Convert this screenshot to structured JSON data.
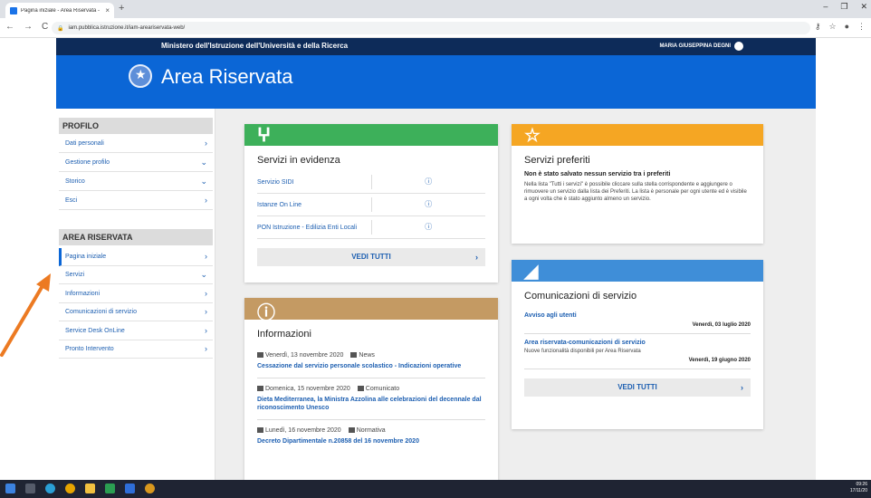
{
  "browser": {
    "tab_title": "Pagina iniziale - Area Riservata -",
    "tab_close": "×",
    "new_tab": "+",
    "url": "iam.pubblica.istruzione.it/iam-areariservata-web/"
  },
  "header": {
    "ministry": "Ministero dell'Istruzione dell'Università e della Ricerca",
    "user_name": "MARIA GIUSEPPINA DEGNI",
    "site_title": "Area Riservata"
  },
  "sidebar": {
    "profilo_title": "PROFILO",
    "profilo_items": [
      {
        "label": "Dati personali",
        "chevron": "›"
      },
      {
        "label": "Gestione profilo",
        "chevron": "⌄"
      },
      {
        "label": "Storico",
        "chevron": "⌄"
      },
      {
        "label": "Esci",
        "chevron": "›"
      }
    ],
    "area_title": "AREA RISERVATA",
    "area_items": [
      {
        "label": "Pagina iniziale",
        "chevron": "›"
      },
      {
        "label": "Servizi",
        "chevron": "⌄"
      },
      {
        "label": "Informazioni",
        "chevron": "›"
      },
      {
        "label": "Comunicazioni di servizio",
        "chevron": "›"
      },
      {
        "label": "Service Desk OnLine",
        "chevron": "›"
      },
      {
        "label": "Pronto Intervento",
        "chevron": "›"
      }
    ]
  },
  "servizi_evidenza": {
    "title": "Servizi in evidenza",
    "items": [
      "Servizio SIDI",
      "Istanze On Line",
      "PON Istruzione - Edilizia Enti Locali"
    ],
    "button": "VEDI TUTTI"
  },
  "servizi_preferiti": {
    "title": "Servizi preferiti",
    "bold": "Non è stato salvato nessun servizio tra i preferiti",
    "text": "Nella lista \"Tutti i servizi\" è possibile cliccare sulla stella corrispondente e aggiungere o rimuovere un servizio dalla lista dei Preferiti. La lista è personale per ogni utente ed è visibile a ogni volta che è stato aggiunto almeno un servizio."
  },
  "informazioni": {
    "title": "Informazioni",
    "news": [
      {
        "date": "Venerdì, 13 novembre 2020",
        "type": "News",
        "title": "Cessazione dal servizio personale scolastico - Indicazioni operative"
      },
      {
        "date": "Domenica, 15 novembre 2020",
        "type": "Comunicato",
        "title": "Dieta Mediterranea, la Ministra Azzolina alle celebrazioni del decennale dal riconoscimento Unesco"
      },
      {
        "date": "Lunedì, 16 novembre 2020",
        "type": "Normativa",
        "title": "Decreto Dipartimentale n.20858 del 16 novembre 2020"
      }
    ]
  },
  "comunicazioni": {
    "title": "Comunicazioni di servizio",
    "items": [
      {
        "link": "Avviso agli utenti",
        "text": "",
        "date": "Venerdì, 03 luglio 2020"
      },
      {
        "link": "Area riservata-comunicazioni di servizio",
        "text": "Nuove funzionalità disponibili per Area Riservata",
        "date": "Venerdì, 19 giugno 2020"
      }
    ],
    "button": "VEDI TUTTI"
  },
  "colors": {
    "green_band": "#3db05a",
    "orange_band": "#f5a623",
    "tan_band": "#c49a63",
    "blue_band": "#3f8ed8",
    "annotation_arrow": "#ec7a22"
  },
  "taskbar": {
    "time": "09:26",
    "date": "17/11/20"
  }
}
